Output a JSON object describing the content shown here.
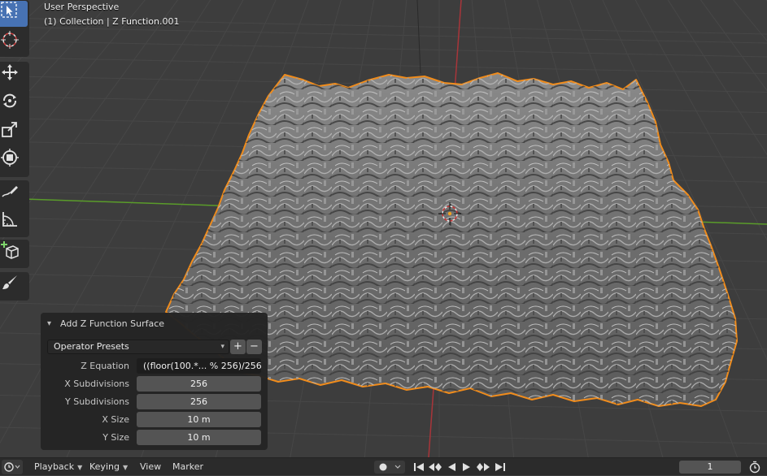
{
  "viewport": {
    "overlay_line1": "User Perspective",
    "overlay_line2": "(1) Collection | Z Function.001",
    "colors": {
      "background": "#3d3d3d",
      "grid": "#474747",
      "x_axis": "#5a9c2a",
      "y_axis": "#a8353a",
      "selection_outline": "#f08c1c"
    }
  },
  "toolbar": {
    "tools": [
      {
        "name": "select-box-icon",
        "active": true
      },
      {
        "name": "cursor-icon",
        "active": false
      },
      {
        "name": "move-icon",
        "active": false
      },
      {
        "name": "rotate-icon",
        "active": false
      },
      {
        "name": "scale-icon",
        "active": false
      },
      {
        "name": "transform-icon",
        "active": false
      },
      {
        "name": "annotate-icon",
        "active": false
      },
      {
        "name": "measure-icon",
        "active": false
      },
      {
        "name": "add-cube-icon",
        "active": false
      },
      {
        "name": "brush-icon",
        "active": false
      }
    ],
    "colors": {
      "active": "#4772b3",
      "panel": "#2c2c2c"
    }
  },
  "redo_panel": {
    "title": "Add Z Function Surface",
    "presets_label": "Operator Presets",
    "add_label": "+",
    "remove_label": "−",
    "fields": [
      {
        "label": "Z Equation",
        "value": "((floor(100.*... % 256)/256"
      },
      {
        "label": "X Subdivisions",
        "value": "256"
      },
      {
        "label": "Y Subdivisions",
        "value": "256"
      },
      {
        "label": "X Size",
        "value": "10 m"
      },
      {
        "label": "Y Size",
        "value": "10 m"
      }
    ]
  },
  "timeline": {
    "menus": {
      "playback": "Playback",
      "keying": "Keying",
      "view": "View",
      "marker": "Marker"
    },
    "current_frame": "1"
  }
}
